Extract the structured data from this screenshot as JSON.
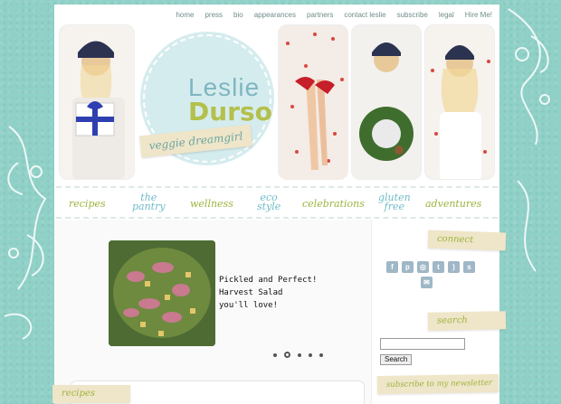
{
  "top_nav": [
    "home",
    "press",
    "bio",
    "appearances",
    "partners",
    "contact leslie",
    "subscribe",
    "legal",
    "Hire Me!"
  ],
  "logo": {
    "first": "Leslie",
    "last": "Durso",
    "tagline": "veggie dreamgirl"
  },
  "main_nav": {
    "recipes": "recipes",
    "pantry_1": "the",
    "pantry_2": "pantry",
    "wellness": "wellness",
    "eco_1": "eco",
    "eco_2": "style",
    "celebrations": "celebrations",
    "gluten_1": "gluten",
    "gluten_2": "free",
    "adventures": "adventures"
  },
  "slideshow": {
    "caption_1": "Pickled and Perfect!",
    "caption_2": "Harvest Salad",
    "caption_3": "you'll love!",
    "dot_count": 5,
    "active_dot": 2
  },
  "sidebar": {
    "connect_label": "connect",
    "search_label": "search",
    "search_button": "Search",
    "newsletter_label": "subscribe to my newsletter",
    "social_icons": [
      "facebook-icon",
      "pinterest-icon",
      "instagram-icon",
      "twitter-icon",
      "rss-icon",
      "stumbleupon-icon",
      "email-icon"
    ]
  },
  "content": {
    "recipes_label": "recipes"
  },
  "colors": {
    "background": "#8fd0c7",
    "green": "#9cb53f",
    "blue": "#6fbcc8",
    "tape": "#efe5c8"
  }
}
